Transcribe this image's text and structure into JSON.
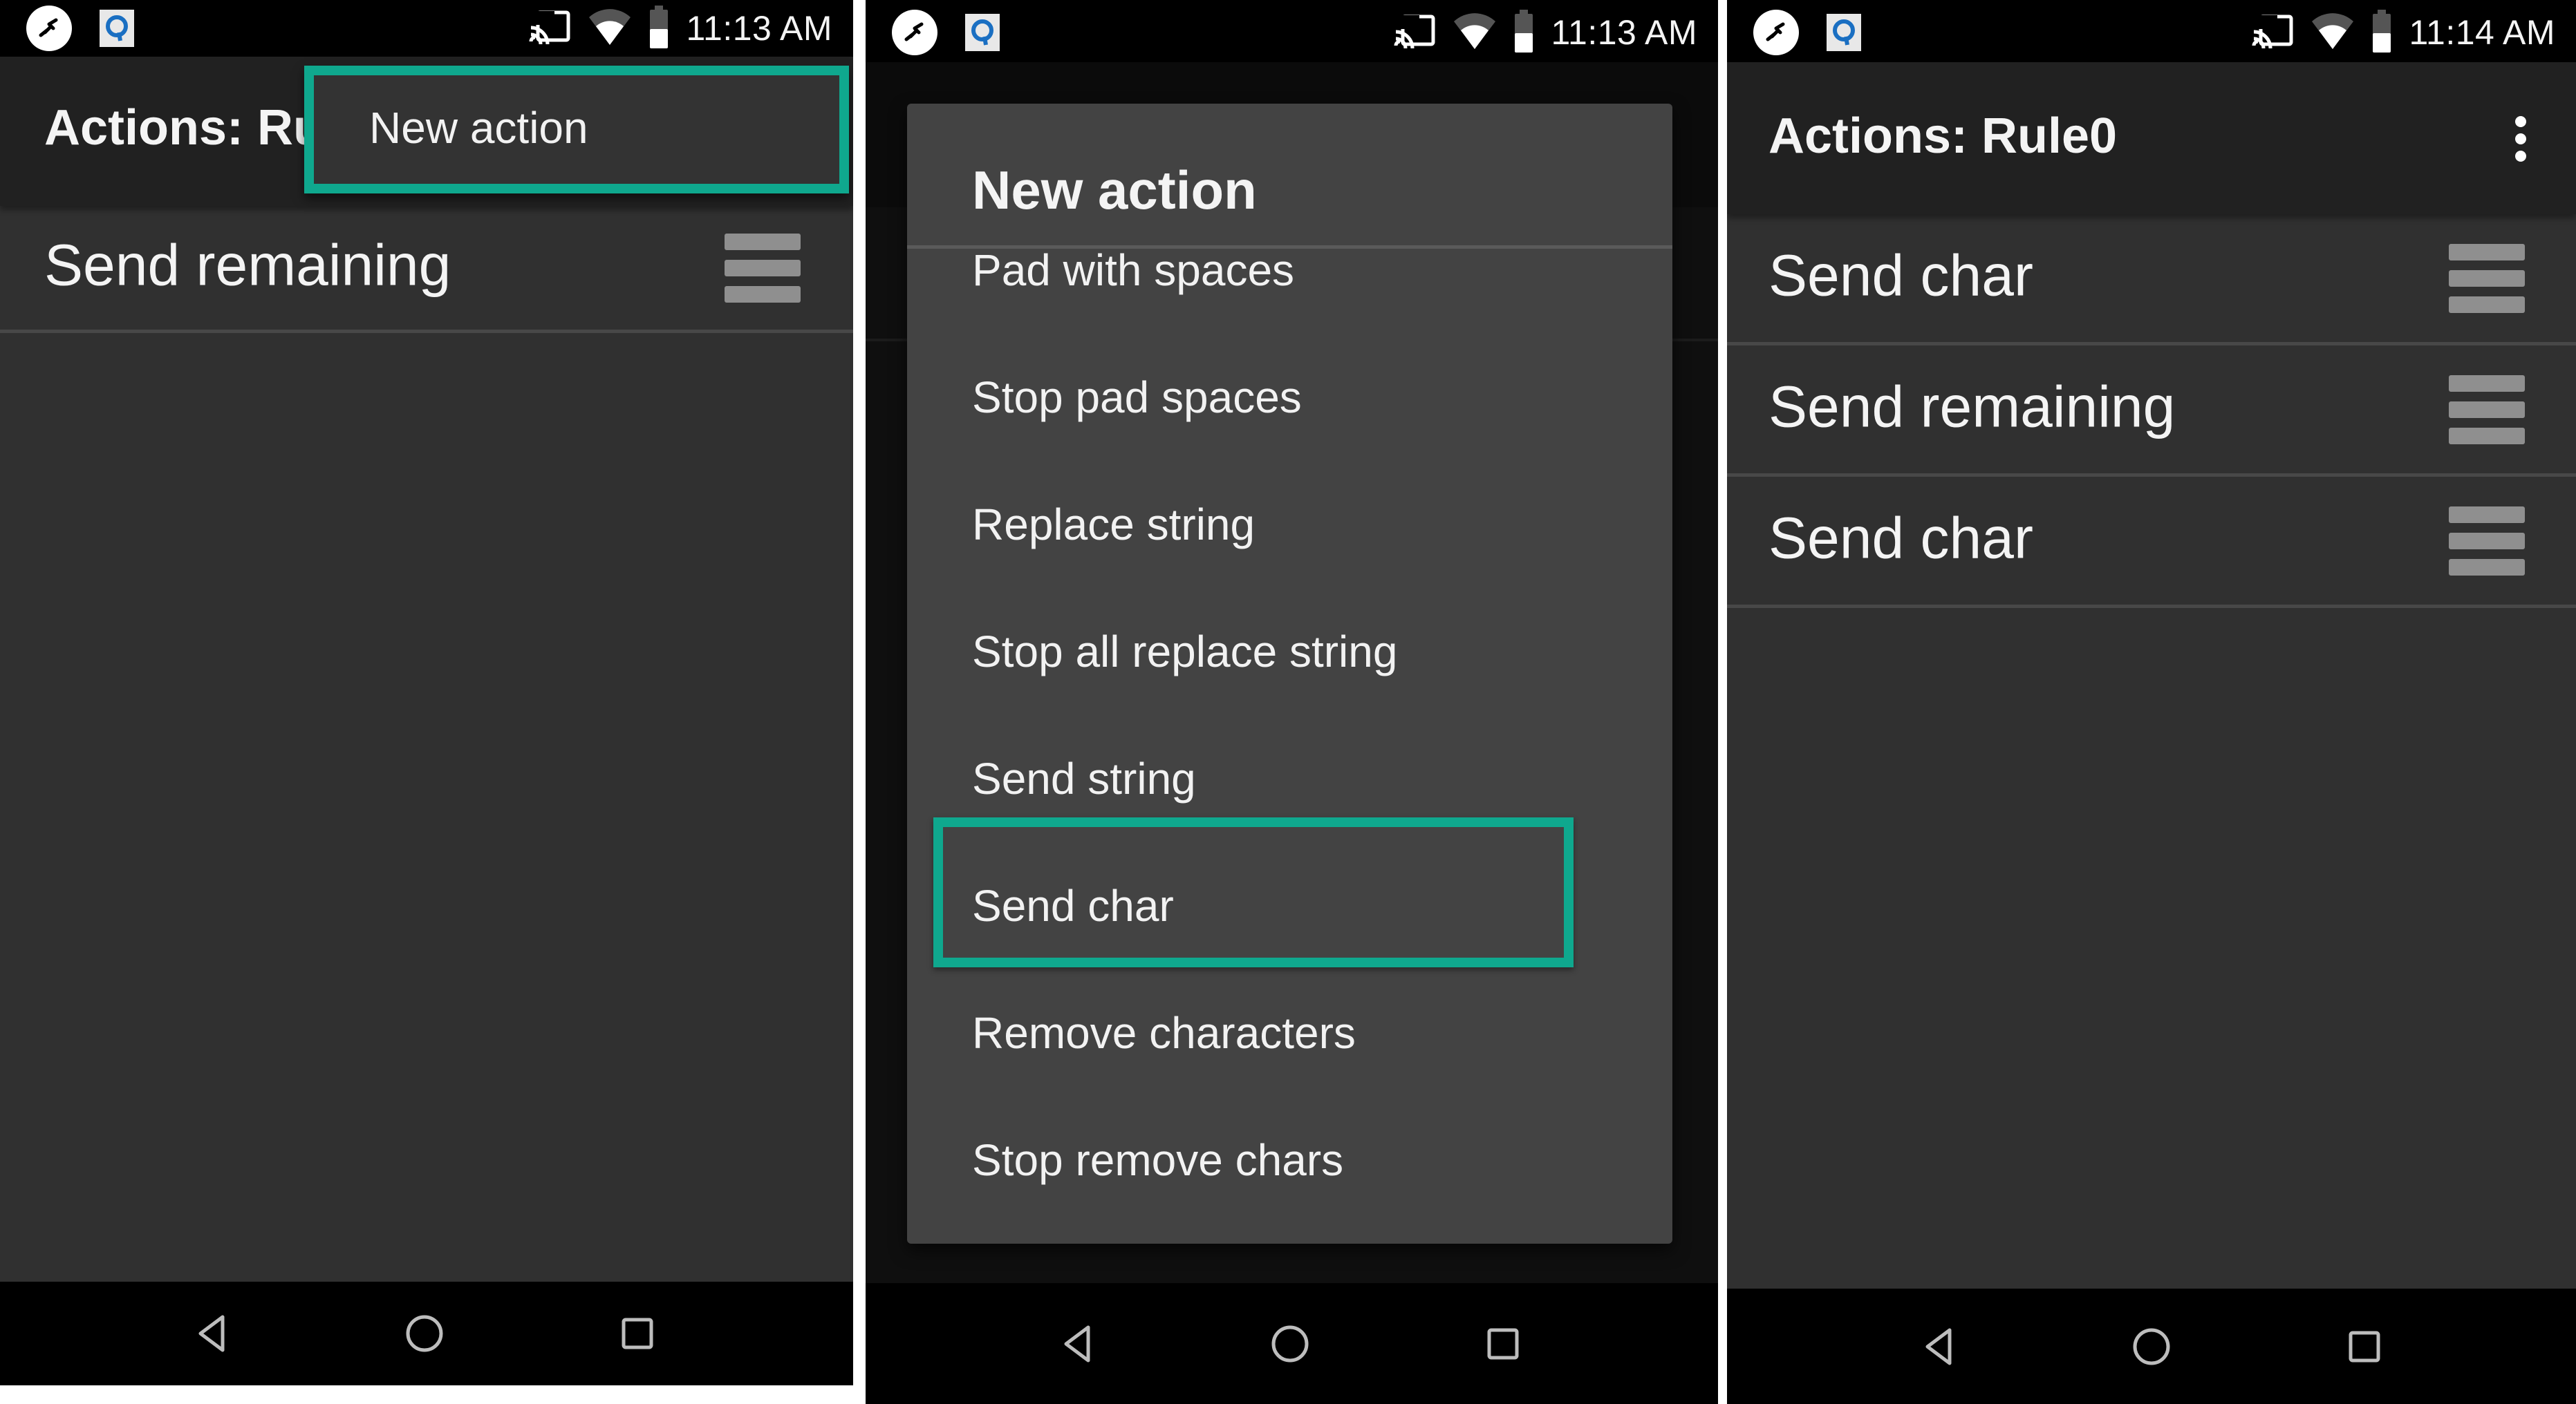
{
  "colors": {
    "highlight": "#0fa88e",
    "app_bar": "#212121",
    "list_bg": "#303030",
    "dialog_bg": "#434343",
    "status_bar": "#000000"
  },
  "panels": [
    {
      "status_bar": {
        "left_icons": [
          "remote-control-icon",
          "q-app-icon"
        ],
        "right_icons": [
          "cast-icon",
          "wifi-icon",
          "battery-icon"
        ],
        "time": "11:13 AM"
      },
      "app_bar": {
        "title": "Actions: Ru"
      },
      "list": [
        {
          "label": "Send remaining",
          "handle_icon": "drag-handle-icon"
        }
      ],
      "popup_menu": {
        "items": [
          {
            "label": "New action",
            "highlighted": true
          }
        ]
      },
      "nav_bar": [
        "back-icon",
        "home-icon",
        "recents-icon"
      ]
    },
    {
      "status_bar": {
        "left_icons": [
          "remote-control-icon",
          "q-app-icon"
        ],
        "right_icons": [
          "cast-icon",
          "wifi-icon",
          "battery-icon"
        ],
        "time": "11:13 AM"
      },
      "dialog": {
        "title": "New action",
        "items": [
          {
            "label": "Pad with spaces"
          },
          {
            "label": "Stop pad spaces"
          },
          {
            "label": "Replace string"
          },
          {
            "label": "Stop all replace string"
          },
          {
            "label": "Send string"
          },
          {
            "label": "Send char",
            "highlighted": true
          },
          {
            "label": "Remove characters"
          },
          {
            "label": "Stop remove chars"
          }
        ]
      },
      "nav_bar": [
        "back-icon",
        "home-icon",
        "recents-icon"
      ]
    },
    {
      "status_bar": {
        "left_icons": [
          "remote-control-icon",
          "q-app-icon"
        ],
        "right_icons": [
          "cast-icon",
          "wifi-icon",
          "battery-icon"
        ],
        "time": "11:14 AM"
      },
      "app_bar": {
        "title": "Actions: Rule0",
        "menu_icon": "more-vert-icon"
      },
      "list": [
        {
          "label": "Send char",
          "handle_icon": "drag-handle-icon"
        },
        {
          "label": "Send remaining",
          "handle_icon": "drag-handle-icon"
        },
        {
          "label": "Send char",
          "handle_icon": "drag-handle-icon"
        }
      ],
      "nav_bar": [
        "back-icon",
        "home-icon",
        "recents-icon"
      ]
    }
  ]
}
